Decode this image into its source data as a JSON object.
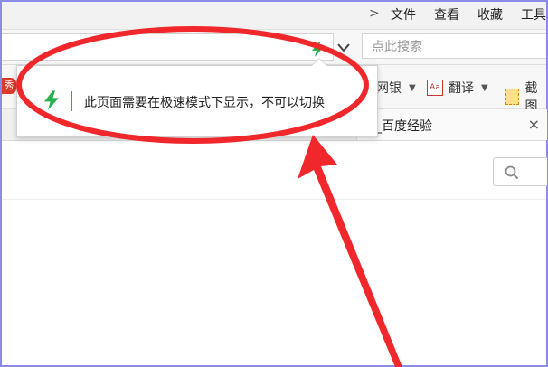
{
  "menu": {
    "chevron": ">",
    "items": [
      "文件",
      "查看",
      "收藏",
      "工具"
    ]
  },
  "address_bar": {
    "mode_icon": "lightning-bolt-icon",
    "dropdown_icon": "chevron-down-icon",
    "search_placeholder": "点此搜索"
  },
  "toolbar": {
    "left_badge": "秀",
    "items": [
      {
        "label": "网银",
        "icon": "",
        "has_caret": true
      },
      {
        "label": "翻译",
        "icon": "Aa",
        "has_caret": true
      },
      {
        "label": "截图",
        "icon": "screenshot-icon",
        "has_caret": false
      }
    ]
  },
  "tab": {
    "title": "器_百度经验",
    "close": "×"
  },
  "popup": {
    "icon": "lightning-bolt-icon",
    "message": "此页面需要在极速模式下显示，不可以切换"
  },
  "annotation": {
    "color": "#f0272b"
  }
}
